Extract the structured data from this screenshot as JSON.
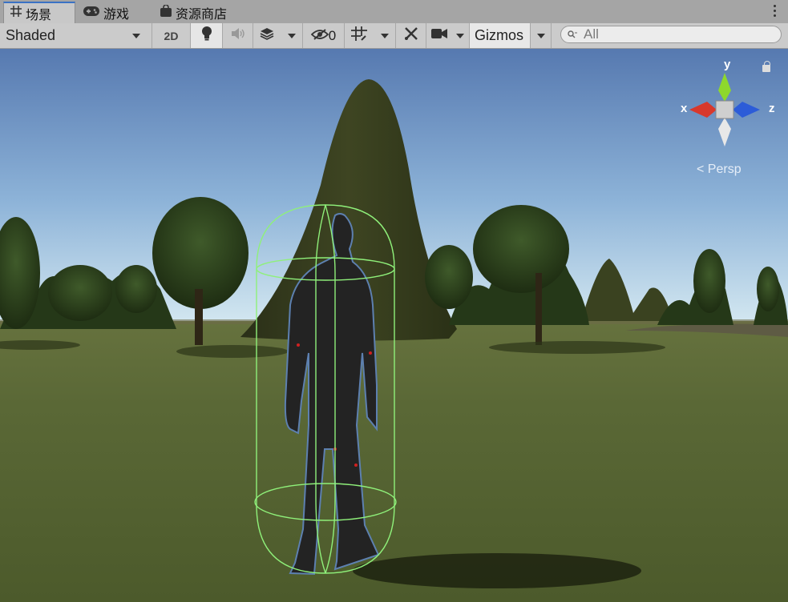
{
  "tabs": [
    {
      "label": "场景",
      "icon": "scene-grid-icon",
      "active": true
    },
    {
      "label": "游戏",
      "icon": "game-controller-icon",
      "active": false
    },
    {
      "label": "资源商店",
      "icon": "asset-store-bag-icon",
      "active": false
    }
  ],
  "toolbar": {
    "draw_mode": "Shaded",
    "mode_2d": "2D",
    "lighting_icon": "light-bulb-icon",
    "audio_icon": "speaker-icon",
    "effects_icon": "layers-icon",
    "hidden_count": "0",
    "hidden_icon": "eye-slash-icon",
    "grid_icon": "grid-snap-icon",
    "tools_icon": "tools-icon",
    "camera_icon": "camera-icon",
    "gizmos_label": "Gizmos",
    "search_placeholder": "All",
    "search_icon": "search-icon"
  },
  "scene_gizmo": {
    "x_label": "x",
    "y_label": "y",
    "z_label": "z",
    "projection": "Persp",
    "lock_icon": "lock-icon",
    "colors": {
      "x": "#d8382c",
      "y": "#8ed82c",
      "z": "#2c5cd8"
    }
  },
  "scene": {
    "sky_top": "#5b80b6",
    "sky_horizon": "#cfe4f0",
    "ground": "#556233",
    "collider_color": "#8ff07a"
  }
}
